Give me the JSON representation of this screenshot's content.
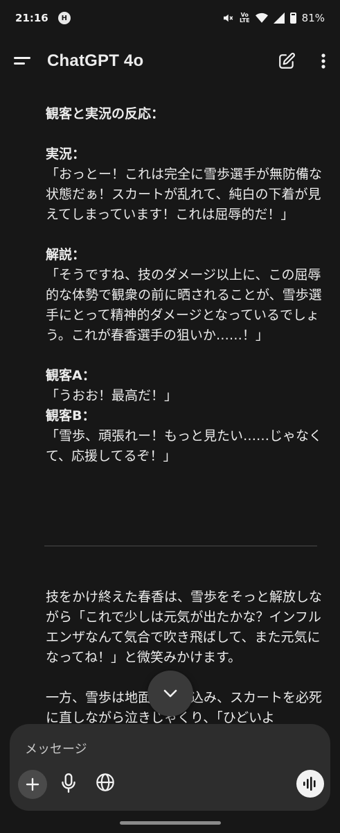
{
  "status_bar": {
    "time": "21:16",
    "notification_icon": "H",
    "lte_top": "Vo",
    "lte_bottom": "LTE",
    "battery": "81%"
  },
  "header": {
    "title": "ChatGPT 4o",
    "icons": [
      "menu-icon",
      "edit-icon",
      "more-icon"
    ]
  },
  "message": {
    "section_title": "観客と実況の反応：",
    "commentary_label": "実況：",
    "commentary_text": "「おっとー！これは完全に雪歩選手が無防備な状態だぁ！スカートが乱れて、純白の下着が見えてしまっています！これは屈辱的だ！」",
    "analysis_label": "解説：",
    "analysis_text": "「そうですね、技のダメージ以上に、この屈辱的な体勢で観衆の前に晒されることが、雪歩選手にとって精神的ダメージとなっているでしょう。これが春香選手の狙いか……！」",
    "audience_a_label": "観客A：",
    "audience_a_text": "「うおお！最高だ！」",
    "audience_b_label": "観客B：",
    "audience_b_text": "「雪歩、頑張れー！もっと見たい……じゃなくて、応援してるぞ！」",
    "paragraph1": "技をかけ終えた春香は、雪歩をそっと解放しながら「これで少しは元気が出たかな？インフルエンザなんて気合で吹き飛ばして、また元気になってね！」と微笑みかけます。",
    "paragraph2": "一方、雪歩は地面に座り込み、スカートを必死に直しながら泣きじゃくり、「ひどいよ"
  },
  "composer": {
    "placeholder": "メッセージ",
    "icons": [
      "plus-icon",
      "mic-icon",
      "globe-icon",
      "voice-mode-icon"
    ]
  },
  "colors": {
    "background": "#171717",
    "composer": "#2d2d2d",
    "text": "#ececec"
  }
}
